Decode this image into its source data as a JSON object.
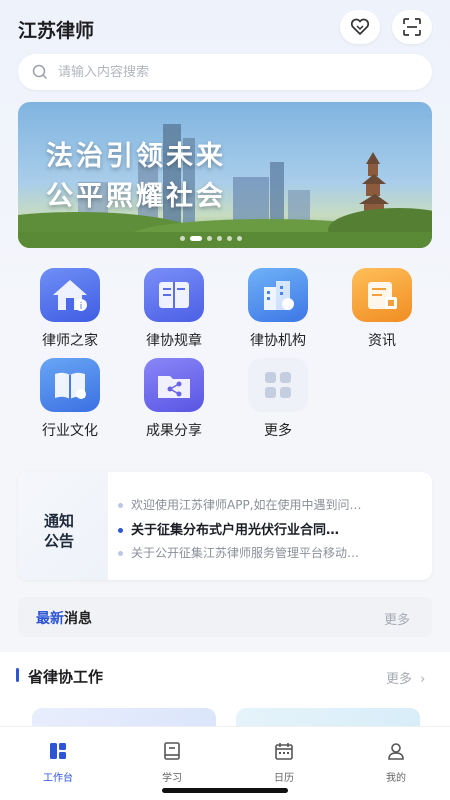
{
  "app": {
    "title": "江苏律师"
  },
  "search": {
    "placeholder": "请输入内容搜索"
  },
  "banner": {
    "line1": "法治引领未来",
    "line2": "公平照耀社会",
    "slide_count": 6,
    "active_slide": 1
  },
  "grid": [
    {
      "label": "律师之家",
      "icon": "lawyer-home-icon"
    },
    {
      "label": "律协规章",
      "icon": "rules-book-icon"
    },
    {
      "label": "律协机构",
      "icon": "institution-building-icon"
    },
    {
      "label": "资讯",
      "icon": "news-icon"
    },
    {
      "label": "行业文化",
      "icon": "culture-book-icon"
    },
    {
      "label": "成果分享",
      "icon": "share-folder-icon"
    },
    {
      "label": "更多",
      "icon": "more-grid-icon"
    }
  ],
  "notice": {
    "title_line1": "通知",
    "title_line2": "公告",
    "items": [
      "欢迎使用江苏律师APP,如在使用中遇到问…",
      "关于征集分布式户用光伏行业合同…",
      "关于公开征集江苏律师服务管理平台移动…"
    ],
    "highlight_index": 1
  },
  "news": {
    "title_accent": "最新",
    "title_rest": "消息",
    "more": "更多"
  },
  "section": {
    "title": "省律协工作",
    "more": "更多"
  },
  "tabs": [
    {
      "label": "工作台",
      "icon": "workbench-icon",
      "active": true
    },
    {
      "label": "学习",
      "icon": "study-icon",
      "active": false
    },
    {
      "label": "日历",
      "icon": "calendar-icon",
      "active": false
    },
    {
      "label": "我的",
      "icon": "profile-icon",
      "active": false
    }
  ],
  "colors": {
    "accent": "#2d55d6",
    "icon_blue": "#4a73f0",
    "icon_orange": "#f29a2e"
  }
}
